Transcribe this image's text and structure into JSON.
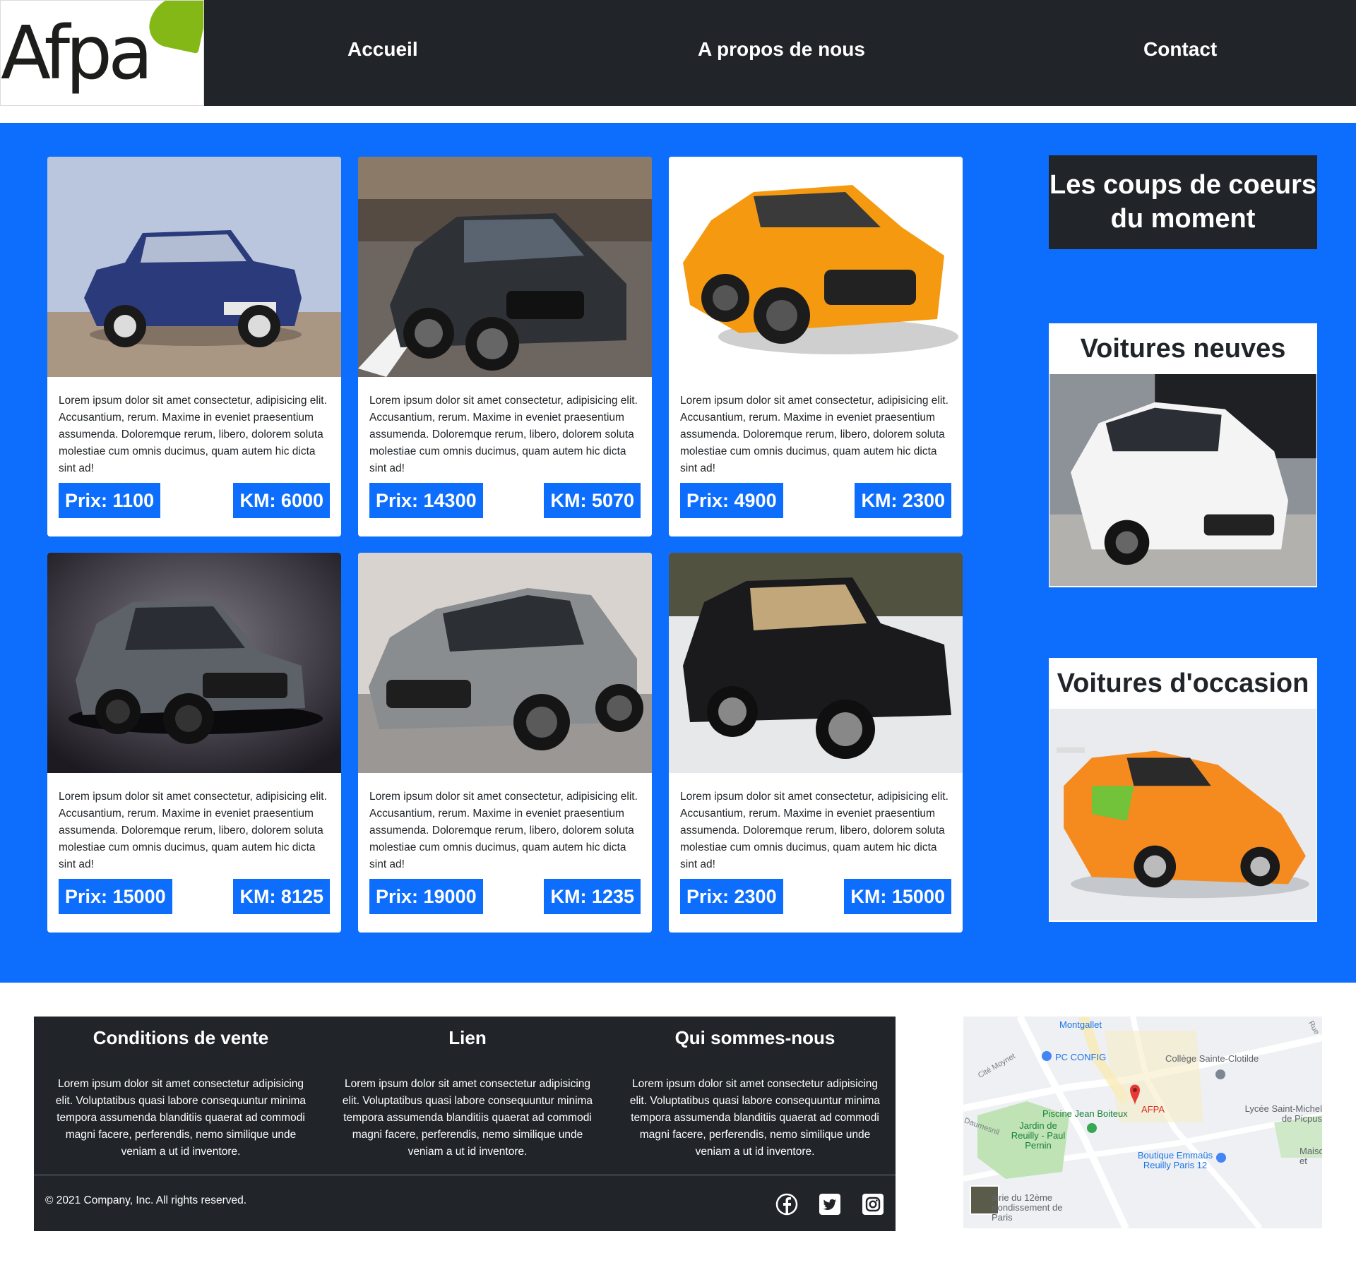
{
  "header": {
    "logo_text": "Afpa",
    "nav": [
      "Accueil",
      "A propos de nous",
      "Contact"
    ]
  },
  "cars": [
    {
      "image": "peugeot-205-blue",
      "text": "Lorem ipsum dolor sit amet consectetur, adipisicing elit. Accusantium, rerum. Maxime in eveniet praesentium assumenda. Doloremque rerum, libero, dolorem soluta molestiae cum omnis ducimus, quam autem hic dicta sint ad!",
      "prix": "Prix: 1100",
      "km": "KM: 6000"
    },
    {
      "image": "audi-a3-dark",
      "text": "Lorem ipsum dolor sit amet consectetur, adipisicing elit. Accusantium, rerum. Maxime in eveniet praesentium assumenda. Doloremque rerum, libero, dolorem soluta molestiae cum omnis ducimus, quam autem hic dicta sint ad!",
      "prix": "Prix: 14300",
      "km": "KM: 5070"
    },
    {
      "image": "mustang-orange",
      "text": "Lorem ipsum dolor sit amet consectetur, adipisicing elit. Accusantium, rerum. Maxime in eveniet praesentium assumenda. Doloremque rerum, libero, dolorem soluta molestiae cum omnis ducimus, quam autem hic dicta sint ad!",
      "prix": "Prix: 4900",
      "km": "KM: 2300"
    },
    {
      "image": "golf-gti-grey",
      "text": "Lorem ipsum dolor sit amet consectetur, adipisicing elit. Accusantium, rerum. Maxime in eveniet praesentium assumenda. Doloremque rerum, libero, dolorem soluta molestiae cum omnis ducimus, quam autem hic dicta sint ad!",
      "prix": "Prix: 15000",
      "km": "KM: 8125"
    },
    {
      "image": "mercedes-a-class-grey",
      "text": "Lorem ipsum dolor sit amet consectetur, adipisicing elit. Accusantium, rerum. Maxime in eveniet praesentium assumenda. Doloremque rerum, libero, dolorem soluta molestiae cum omnis ducimus, quam autem hic dicta sint ad!",
      "prix": "Prix: 19000",
      "km": "KM: 1235"
    },
    {
      "image": "renault-5-turbo-black",
      "text": "Lorem ipsum dolor sit amet consectetur, adipisicing elit. Accusantium, rerum. Maxime in eveniet praesentium assumenda. Doloremque rerum, libero, dolorem soluta molestiae cum omnis ducimus, quam autem hic dicta sint ad!",
      "prix": "Prix: 2300",
      "km": "KM: 15000"
    }
  ],
  "sidebar": {
    "highlight_title": "Les coups de coeurs du moment",
    "new_cars_title": "Voitures neuves",
    "used_cars_title": "Voitures d'occasion"
  },
  "footer": {
    "columns": [
      {
        "title": "Conditions de vente",
        "text": "Lorem ipsum dolor sit amet consectetur adipisicing elit. Voluptatibus quasi labore consequuntur minima tempora assumenda blanditiis quaerat ad commodi magni facere, perferendis, nemo similique unde veniam a ut id inventore."
      },
      {
        "title": "Lien",
        "text": "Lorem ipsum dolor sit amet consectetur adipisicing elit. Voluptatibus quasi labore consequuntur minima tempora assumenda blanditiis quaerat ad commodi magni facere, perferendis, nemo similique unde veniam a ut id inventore."
      },
      {
        "title": "Qui sommes-nous",
        "text": "Lorem ipsum dolor sit amet consectetur adipisicing elit. Voluptatibus quasi labore consequuntur minima tempora assumenda blanditiis quaerat ad commodi magni facere, perferendis, nemo similique unde veniam a ut id inventore."
      }
    ],
    "copyright": "© 2021 Company, Inc. All rights reserved.",
    "social": [
      "facebook-icon",
      "twitter-icon",
      "instagram-icon"
    ]
  },
  "map": {
    "labels": [
      "Montgallet",
      "PC CONFIG",
      "Collège Sainte-Clotilde",
      "AFPA",
      "Piscine Jean Boiteux",
      "Jardin de Reuilly - Paul Pernin",
      "Lycée Saint-Michel de Picpus",
      "Boutique Emmaüs Reuilly Paris 12",
      "Maiso et",
      "airie du 12ème rrondissement de Paris",
      "Cité Moynet",
      "Daumesnil",
      "Rue"
    ]
  },
  "colors": {
    "primary": "#0d6efd",
    "dark": "#212529",
    "logo_green": "#84b817",
    "map_pin": "#e53935"
  }
}
